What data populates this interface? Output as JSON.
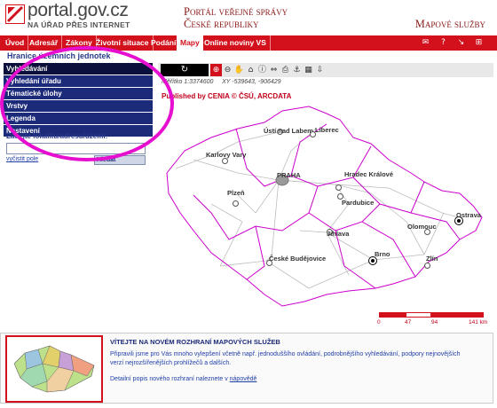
{
  "header": {
    "logo_title": "portal.gov.cz",
    "logo_subtitle": "NA ÚŘAD PŘES INTERNET",
    "portal_line1": "Portál veřejné správy",
    "portal_line2": "České republiky",
    "map_services": "Mapové služby"
  },
  "nav": {
    "items": [
      "Úvod",
      "Adresář",
      "Zákony",
      "Životní situace",
      "Podání",
      "Mapy",
      "Online noviny VS"
    ],
    "active": "Mapy"
  },
  "page_heading": "Hranice územních jednotek",
  "panel": {
    "items": [
      "Vyhledávání",
      "Vyhledání úřadu",
      "Tématické úlohy",
      "Vrstvy",
      "Legenda",
      "Nastavení"
    ],
    "search_label": "Zadejte lokalitu/adresu/území:",
    "search_value": "",
    "link": "vyčistit pole",
    "button": "Hledat"
  },
  "map": {
    "scale_label": "Měřítko 1:3374600",
    "coords_label": "XY -539643, -906429",
    "published": "Published by CENIA  © ČSÚ, ARCDATA",
    "cities": [
      "Ústí nad Labem",
      "Liberec",
      "Karlovy Vary",
      "PRAHA",
      "Hradec Králové",
      "Pardubice",
      "Plzeň",
      "Jihlava",
      "Olomouc",
      "Ostrava",
      "Brno",
      "Zlín",
      "České Budějovice"
    ],
    "scale_ticks": [
      "0",
      "47",
      "94",
      "141 km"
    ],
    "colors": {
      "border": "#cc00cc",
      "road": "#bbbbbb",
      "accent": "#d3111c"
    }
  },
  "welcome": {
    "title": "VÍTEJTE NA NOVÉM ROZHRANÍ MAPOVÝCH SLUŽEB",
    "text": "Připravili jsme pro Vás mnoho vylepšení včetně např. jednoduššího ovládání, podrobnějšího vyhledávání, podpory nejnovějších verzí nejrozšířenějších prohlížečů a dalších.",
    "text2_prefix": "Detailní popis nového rozhraní naleznete v ",
    "text2_link": "nápovědě"
  }
}
